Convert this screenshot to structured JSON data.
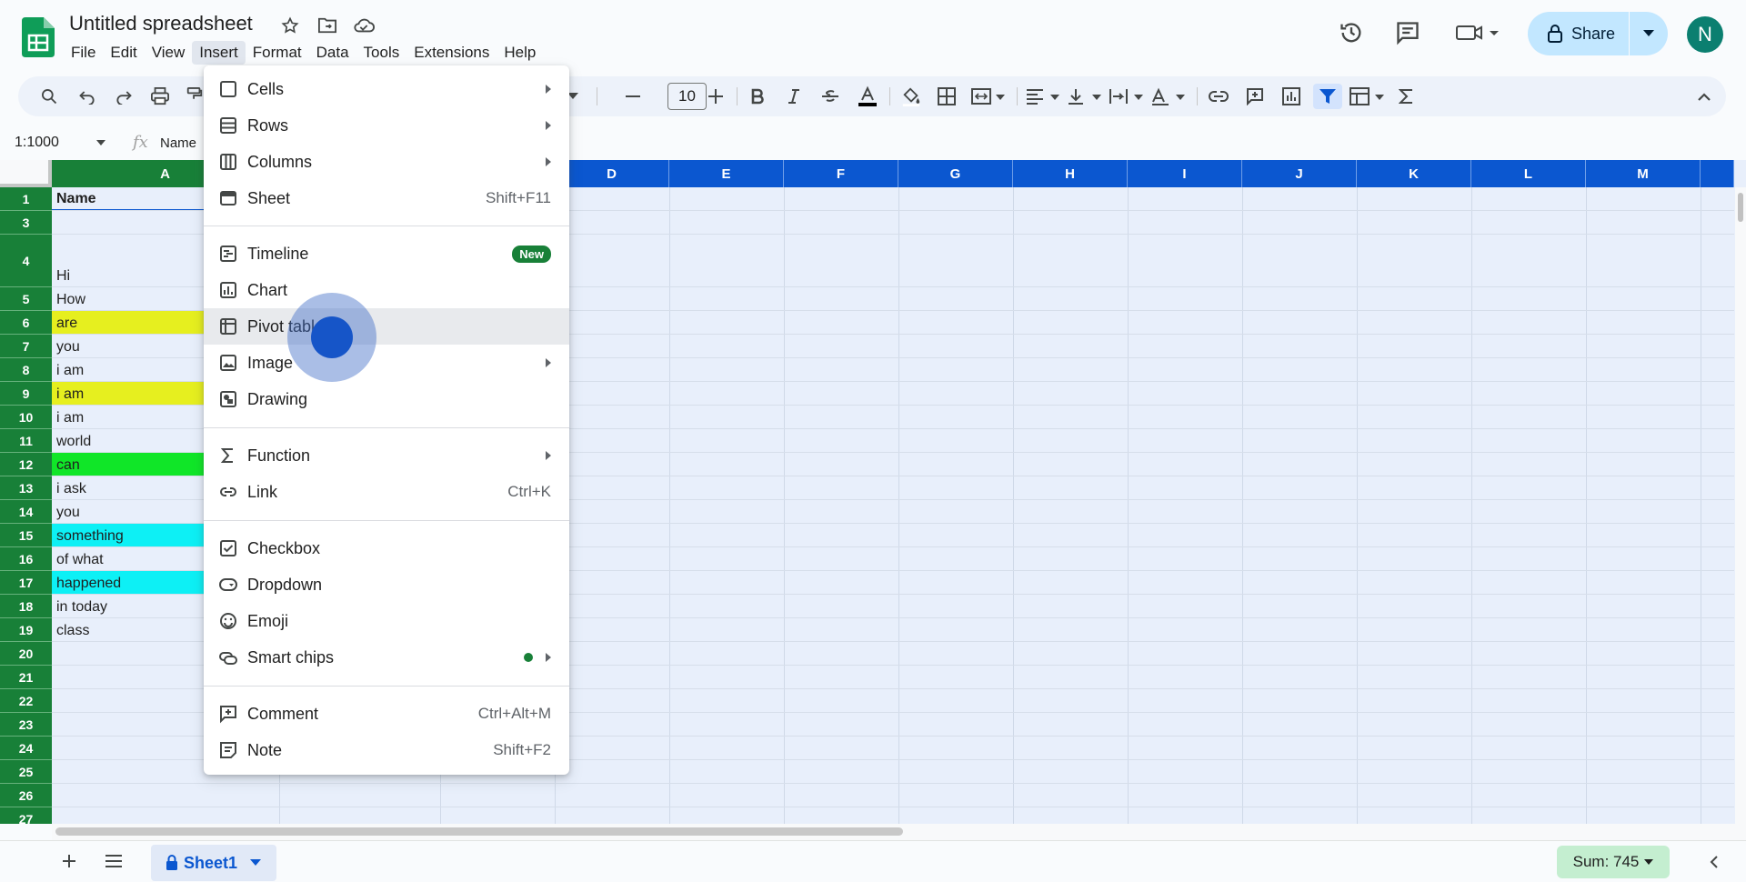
{
  "app": {
    "doc_title": "Untitled spreadsheet",
    "menus": [
      "File",
      "Edit",
      "View",
      "Insert",
      "Format",
      "Data",
      "Tools",
      "Extensions",
      "Help"
    ],
    "active_menu": "Insert",
    "share_label": "Share",
    "avatar_initial": "N",
    "accent": "#0b57d0",
    "header_green": "#188038"
  },
  "toolbar": {
    "font_size": "10"
  },
  "formula_bar": {
    "name_box": "1:1000",
    "fx": "fx",
    "content": "Name"
  },
  "grid": {
    "columns": [
      "A",
      "D",
      "E",
      "F",
      "G",
      "H",
      "I",
      "J",
      "K",
      "L",
      "M"
    ],
    "rows": [
      {
        "num": "1",
        "value": "Name",
        "fill": "",
        "bold": true
      },
      {
        "num": "3",
        "value": "",
        "fill": ""
      },
      {
        "num": "4",
        "value": "Hi",
        "fill": ""
      },
      {
        "num": "5",
        "value": "How",
        "fill": ""
      },
      {
        "num": "6",
        "value": "are",
        "fill": "#e6ef1f"
      },
      {
        "num": "7",
        "value": "you",
        "fill": ""
      },
      {
        "num": "8",
        "value": "i am",
        "fill": ""
      },
      {
        "num": "9",
        "value": "i am",
        "fill": "#e6ef1f"
      },
      {
        "num": "10",
        "value": "i am",
        "fill": ""
      },
      {
        "num": "11",
        "value": "world",
        "fill": ""
      },
      {
        "num": "12",
        "value": "can",
        "fill": "#10e628"
      },
      {
        "num": "13",
        "value": "i ask",
        "fill": ""
      },
      {
        "num": "14",
        "value": "you",
        "fill": ""
      },
      {
        "num": "15",
        "value": "something",
        "fill": "#0df0f5"
      },
      {
        "num": "16",
        "value": "of what",
        "fill": ""
      },
      {
        "num": "17",
        "value": "happened",
        "fill": "#0df0f5"
      },
      {
        "num": "18",
        "value": "in today",
        "fill": ""
      },
      {
        "num": "19",
        "value": "class",
        "fill": ""
      },
      {
        "num": "20",
        "value": "",
        "fill": ""
      },
      {
        "num": "21",
        "value": "",
        "fill": ""
      },
      {
        "num": "22",
        "value": "",
        "fill": ""
      },
      {
        "num": "23",
        "value": "",
        "fill": ""
      },
      {
        "num": "24",
        "value": "",
        "fill": ""
      },
      {
        "num": "25",
        "value": "",
        "fill": ""
      },
      {
        "num": "26",
        "value": "",
        "fill": ""
      },
      {
        "num": "27",
        "value": "",
        "fill": ""
      }
    ]
  },
  "insert_menu": {
    "items": [
      {
        "label": "Cells",
        "icon": "cells-icon",
        "submenu": true
      },
      {
        "label": "Rows",
        "icon": "rows-icon",
        "submenu": true
      },
      {
        "label": "Columns",
        "icon": "columns-icon",
        "submenu": true
      },
      {
        "label": "Sheet",
        "icon": "sheet-icon",
        "shortcut": "Shift+F11"
      },
      {
        "label": "Timeline",
        "icon": "timeline-icon",
        "badge": "New"
      },
      {
        "label": "Chart",
        "icon": "chart-icon"
      },
      {
        "label": "Pivot table",
        "icon": "pivot-table-icon"
      },
      {
        "label": "Image",
        "icon": "image-icon",
        "submenu": true
      },
      {
        "label": "Drawing",
        "icon": "drawing-icon"
      },
      {
        "label": "Function",
        "icon": "function-icon",
        "submenu": true
      },
      {
        "label": "Link",
        "icon": "link-icon",
        "shortcut": "Ctrl+K"
      },
      {
        "label": "Checkbox",
        "icon": "checkbox-icon"
      },
      {
        "label": "Dropdown",
        "icon": "dropdown-icon"
      },
      {
        "label": "Emoji",
        "icon": "emoji-icon"
      },
      {
        "label": "Smart chips",
        "icon": "smart-chips-icon",
        "submenu": true
      },
      {
        "label": "Comment",
        "icon": "comment-icon",
        "shortcut": "Ctrl+Alt+M"
      },
      {
        "label": "Note",
        "icon": "note-icon",
        "shortcut": "Shift+F2"
      }
    ]
  },
  "bottom": {
    "sheet_tab": "Sheet1",
    "sum": "Sum: 745"
  }
}
